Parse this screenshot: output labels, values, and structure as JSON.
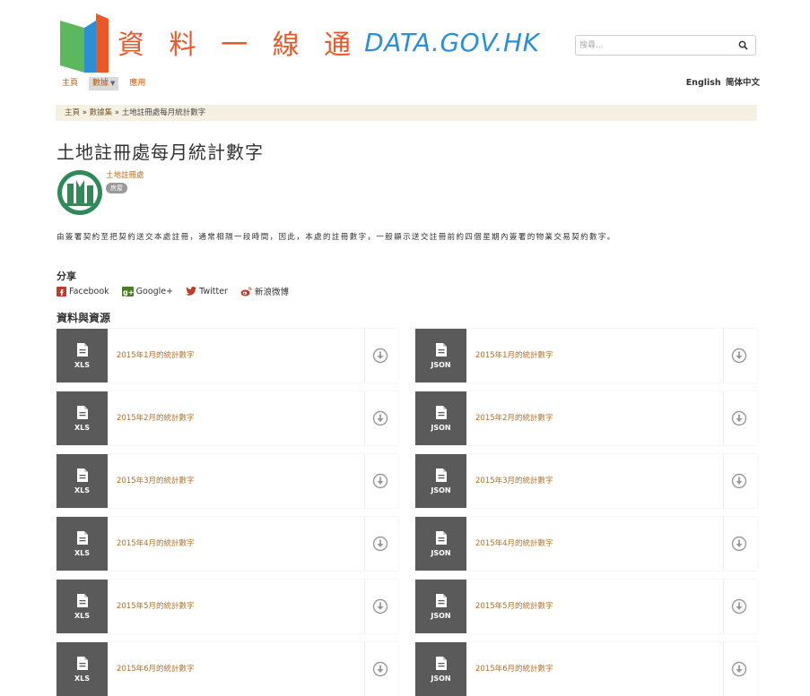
{
  "header": {
    "logo_cn": "資 料 一 線 通",
    "logo_en": "DATA.GOV.HK",
    "search_placeholder": "搜尋...",
    "nav": [
      {
        "label": "主頁"
      },
      {
        "label": "數據",
        "active": true
      },
      {
        "label": "應用"
      }
    ],
    "lang": [
      "English",
      "简体中文"
    ]
  },
  "breadcrumb": {
    "home": "主頁",
    "sep1": " » ",
    "datasets": "數據集",
    "sep2": " » ",
    "current": "土地註冊處每月統計數字"
  },
  "page_title": "土地註冊處每月統計數字",
  "organization": {
    "name": "土地註冊處",
    "badge": "房屋"
  },
  "description": "由簽署契約至把契約送交本處註冊，通常相隔一段時間，因此，本處的註冊數字，一般顯示送交註冊前約四個星期內簽署的物業交易契約數字。",
  "share": {
    "heading": "分享",
    "items": [
      "Facebook",
      "Google+",
      "Twitter",
      "新浪微博"
    ]
  },
  "resources": {
    "heading": "資料與資源",
    "left": [
      {
        "format": "XLS",
        "title": "2015年1月的統計數字"
      },
      {
        "format": "XLS",
        "title": "2015年2月的統計數字"
      },
      {
        "format": "XLS",
        "title": "2015年3月的統計數字"
      },
      {
        "format": "XLS",
        "title": "2015年4月的統計數字"
      },
      {
        "format": "XLS",
        "title": "2015年5月的統計數字"
      },
      {
        "format": "XLS",
        "title": "2015年6月的統計數字"
      }
    ],
    "right": [
      {
        "format": "JSON",
        "title": "2015年1月的統計數字"
      },
      {
        "format": "JSON",
        "title": "2015年2月的統計數字"
      },
      {
        "format": "JSON",
        "title": "2015年3月的統計數字"
      },
      {
        "format": "JSON",
        "title": "2015年4月的統計數字"
      },
      {
        "format": "JSON",
        "title": "2015年5月的統計數字"
      },
      {
        "format": "JSON",
        "title": "2015年6月的統計數字"
      }
    ]
  },
  "colors": {
    "logo_orange": "#ea5827",
    "logo_blue": "#2b8fd6",
    "link_brown": "#b0702a",
    "format_block": "#5a5a5a",
    "breadcrumb_bg": "#f5f0e1"
  }
}
